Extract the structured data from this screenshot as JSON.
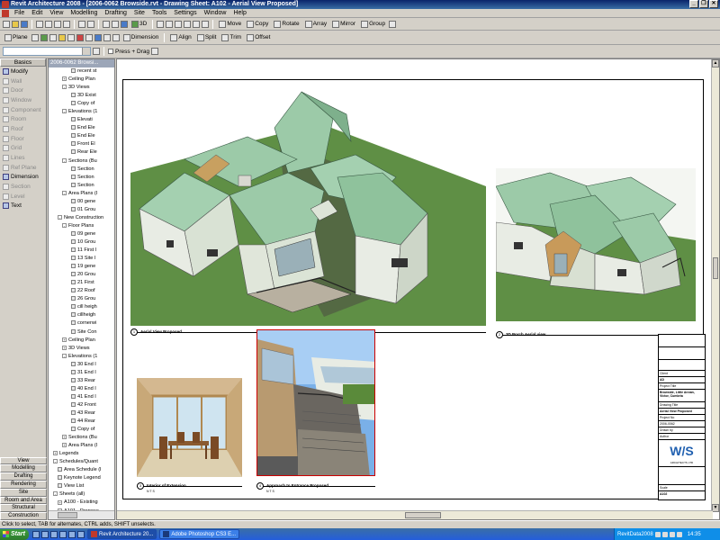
{
  "window": {
    "title": "Revit Architecture 2008 - [2006-0062 Browside.rvt - Drawing Sheet: A102 - Aerial View Proposed]"
  },
  "menu": [
    "File",
    "Edit",
    "View",
    "Modelling",
    "Drafting",
    "Site",
    "Tools",
    "Settings",
    "Window",
    "Help"
  ],
  "toolbar1": {
    "view3d": "3D",
    "move": "Move",
    "copy": "Copy",
    "rotate": "Rotate",
    "array": "Array",
    "mirror": "Mirror",
    "group": "Group"
  },
  "toolbar2": {
    "plane": "Plane",
    "dimlabel": "Dimension",
    "align": "Align",
    "split": "Split",
    "trim": "Trim",
    "offset": "Offset"
  },
  "toolbar3": {
    "press_drag": "Press + Drag"
  },
  "design_bar": {
    "tab": "Basics",
    "items": [
      {
        "label": "Modify",
        "on": true
      },
      {
        "label": "Wall",
        "on": false
      },
      {
        "label": "Door",
        "on": false
      },
      {
        "label": "Window",
        "on": false
      },
      {
        "label": "Component",
        "on": false
      },
      {
        "label": "Room",
        "on": false
      },
      {
        "label": "Roof",
        "on": false
      },
      {
        "label": "Floor",
        "on": false
      },
      {
        "label": "Grid",
        "on": false
      },
      {
        "label": "Lines",
        "on": false
      },
      {
        "label": "Ref Plane",
        "on": false
      },
      {
        "label": "Dimension",
        "on": true
      },
      {
        "label": "Section",
        "on": false
      },
      {
        "label": "Level",
        "on": false
      },
      {
        "label": "Text",
        "on": true
      }
    ],
    "bottom_tabs": [
      "View",
      "Modelling",
      "Drafting",
      "Rendering",
      "Site",
      "Room and Area",
      "Structural",
      "Construction"
    ]
  },
  "project_browser": {
    "header": "2006-0062 Browsi...",
    "items": [
      {
        "indent": 5,
        "label": "recent st",
        "exp": ""
      },
      {
        "indent": 3,
        "label": "Ceiling Plan",
        "exp": "+"
      },
      {
        "indent": 3,
        "label": "3D Views",
        "exp": "-"
      },
      {
        "indent": 5,
        "label": "3D Exist",
        "exp": ""
      },
      {
        "indent": 5,
        "label": "Copy of",
        "exp": ""
      },
      {
        "indent": 3,
        "label": "Elevations (1",
        "exp": "-"
      },
      {
        "indent": 5,
        "label": "Elevati",
        "exp": ""
      },
      {
        "indent": 5,
        "label": "End Ele",
        "exp": ""
      },
      {
        "indent": 5,
        "label": "End Ele",
        "exp": ""
      },
      {
        "indent": 5,
        "label": "Front El",
        "exp": ""
      },
      {
        "indent": 5,
        "label": "Rear Ele",
        "exp": ""
      },
      {
        "indent": 3,
        "label": "Sections (Bu",
        "exp": "-"
      },
      {
        "indent": 5,
        "label": "Section",
        "exp": ""
      },
      {
        "indent": 5,
        "label": "Section",
        "exp": ""
      },
      {
        "indent": 5,
        "label": "Section",
        "exp": ""
      },
      {
        "indent": 3,
        "label": "Area Plans (I",
        "exp": "-"
      },
      {
        "indent": 5,
        "label": "00 gene",
        "exp": ""
      },
      {
        "indent": 5,
        "label": "01 Grou",
        "exp": ""
      },
      {
        "indent": 2,
        "label": "New Construction",
        "exp": "-"
      },
      {
        "indent": 3,
        "label": "Floor Plans",
        "exp": "-"
      },
      {
        "indent": 5,
        "label": "09 gene",
        "exp": ""
      },
      {
        "indent": 5,
        "label": "10 Grou",
        "exp": ""
      },
      {
        "indent": 5,
        "label": "11 First l",
        "exp": ""
      },
      {
        "indent": 5,
        "label": "13 Site l",
        "exp": ""
      },
      {
        "indent": 5,
        "label": "19 gene",
        "exp": ""
      },
      {
        "indent": 5,
        "label": "20 Grou",
        "exp": ""
      },
      {
        "indent": 5,
        "label": "21 First",
        "exp": ""
      },
      {
        "indent": 5,
        "label": "22 Roof",
        "exp": ""
      },
      {
        "indent": 5,
        "label": "26 Grou",
        "exp": ""
      },
      {
        "indent": 5,
        "label": "cill heigh",
        "exp": ""
      },
      {
        "indent": 5,
        "label": "cillheigh",
        "exp": ""
      },
      {
        "indent": 5,
        "label": "cornerwi",
        "exp": ""
      },
      {
        "indent": 5,
        "label": "Site Con",
        "exp": ""
      },
      {
        "indent": 3,
        "label": "Ceiling Plan",
        "exp": "+"
      },
      {
        "indent": 3,
        "label": "3D Views",
        "exp": "+"
      },
      {
        "indent": 3,
        "label": "Elevations (1",
        "exp": "-"
      },
      {
        "indent": 5,
        "label": "30 End I",
        "exp": ""
      },
      {
        "indent": 5,
        "label": "31 End I",
        "exp": ""
      },
      {
        "indent": 5,
        "label": "33 Rear",
        "exp": ""
      },
      {
        "indent": 5,
        "label": "40 End I",
        "exp": ""
      },
      {
        "indent": 5,
        "label": "41 End I",
        "exp": ""
      },
      {
        "indent": 5,
        "label": "42 Front",
        "exp": ""
      },
      {
        "indent": 5,
        "label": "43 Rear",
        "exp": ""
      },
      {
        "indent": 5,
        "label": "44 Rear",
        "exp": ""
      },
      {
        "indent": 5,
        "label": "Copy of",
        "exp": ""
      },
      {
        "indent": 3,
        "label": "Sections (Bu",
        "exp": "+"
      },
      {
        "indent": 3,
        "label": "Area Plans (I",
        "exp": "+"
      },
      {
        "indent": 1,
        "label": "Legends",
        "exp": "+"
      },
      {
        "indent": 1,
        "label": "Schedules/Quant",
        "exp": "-"
      },
      {
        "indent": 2,
        "label": "Area Schedule (l",
        "exp": ""
      },
      {
        "indent": 2,
        "label": "Keynote Legend",
        "exp": ""
      },
      {
        "indent": 2,
        "label": "View List",
        "exp": ""
      },
      {
        "indent": 1,
        "label": "Sheets (all)",
        "exp": "-"
      },
      {
        "indent": 2,
        "label": "A100 - Existing",
        "exp": "+"
      },
      {
        "indent": 2,
        "label": "A101 - Propose",
        "exp": "+"
      },
      {
        "indent": 2,
        "label": "A102 - Aerial V",
        "exp": "+"
      },
      {
        "indent": 2,
        "label": "A103 - Unname",
        "exp": "+"
      },
      {
        "indent": 1,
        "label": "Families",
        "exp": "+"
      },
      {
        "indent": 1,
        "label": "Groups",
        "exp": "+"
      },
      {
        "indent": 1,
        "label": "Revit Links",
        "exp": ""
      }
    ]
  },
  "sheet": {
    "captions": [
      {
        "num": "1",
        "title": "Aerial View Proposed",
        "scale": ""
      },
      {
        "num": "2",
        "title": "3D Porch Aerial view",
        "scale": ""
      },
      {
        "num": "3",
        "title": "Interior of Extension",
        "scale": "N T S"
      },
      {
        "num": "4",
        "title": "Approach to Entrance Proposed",
        "scale": "N T S"
      }
    ],
    "title_block": {
      "rows": [
        "Client",
        "AD",
        "Project Title",
        "Browside, Little Annan, Victor, Cumbria",
        "Drawing Title",
        "Aerial View Proposed",
        "Project No",
        "2006-0062",
        "Drawn by",
        "Author",
        "Scale",
        "A102"
      ],
      "logo": "W/S",
      "logo_sub": "ARCHITECTS LTD"
    }
  },
  "statusbar": "Click to select, TAB for alternates, CTRL adds, SHIFT unselects.",
  "taskbar": {
    "start": "Start",
    "tasks": [
      {
        "label": "Revit Architecture 20...",
        "active": true
      },
      {
        "label": "Adobe Photoshop CS3 E...",
        "active": false
      }
    ],
    "tray_label": "RevitData2008",
    "clock": "14:35"
  },
  "colors": {
    "roof": "#9ccaa8",
    "grass": "#6a9a4a",
    "wall": "#e8ece4",
    "accent": "#0a246a"
  }
}
